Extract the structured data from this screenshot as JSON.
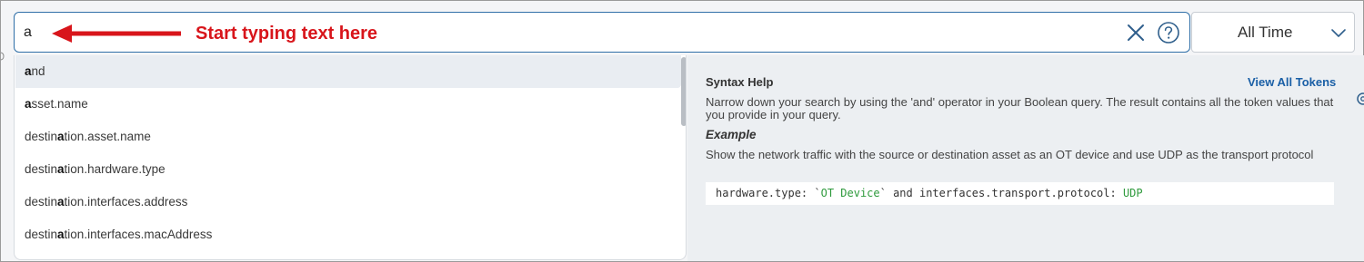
{
  "search": {
    "value": "a",
    "clear_icon": "close-icon",
    "help_icon": "question-circle-icon"
  },
  "annotation": {
    "text": "Start typing text here",
    "color": "#d8151b"
  },
  "time_range": {
    "selected": "All Time"
  },
  "suggestions": [
    {
      "match": "a",
      "rest": "nd"
    },
    {
      "match": "a",
      "rest": "sset.name"
    },
    {
      "pre": "destin",
      "match": "a",
      "rest": "tion.asset.name"
    },
    {
      "pre": "destin",
      "match": "a",
      "rest": "tion.hardware.type"
    },
    {
      "pre": "destin",
      "match": "a",
      "rest": "tion.interfaces.address"
    },
    {
      "pre": "destin",
      "match": "a",
      "rest": "tion.interfaces.macAddress"
    }
  ],
  "help": {
    "title": "Syntax Help",
    "view_all": "View All Tokens",
    "description": "Narrow down your search by using the 'and' operator in your Boolean query. The result contains all the token values that you provide in your query.",
    "example_title": "Example",
    "example_description": "Show the network traffic with the source or destination asset as an OT device and use UDP as the transport protocol",
    "code": {
      "part1": "hardware.type: `",
      "value1": "OT Device",
      "part2": "` and interfaces.transport.protocol: ",
      "value2": "UDP"
    }
  },
  "colors": {
    "accent": "#2f6fa7",
    "link": "#1a5fa6",
    "code_value": "#2e9a3c"
  }
}
